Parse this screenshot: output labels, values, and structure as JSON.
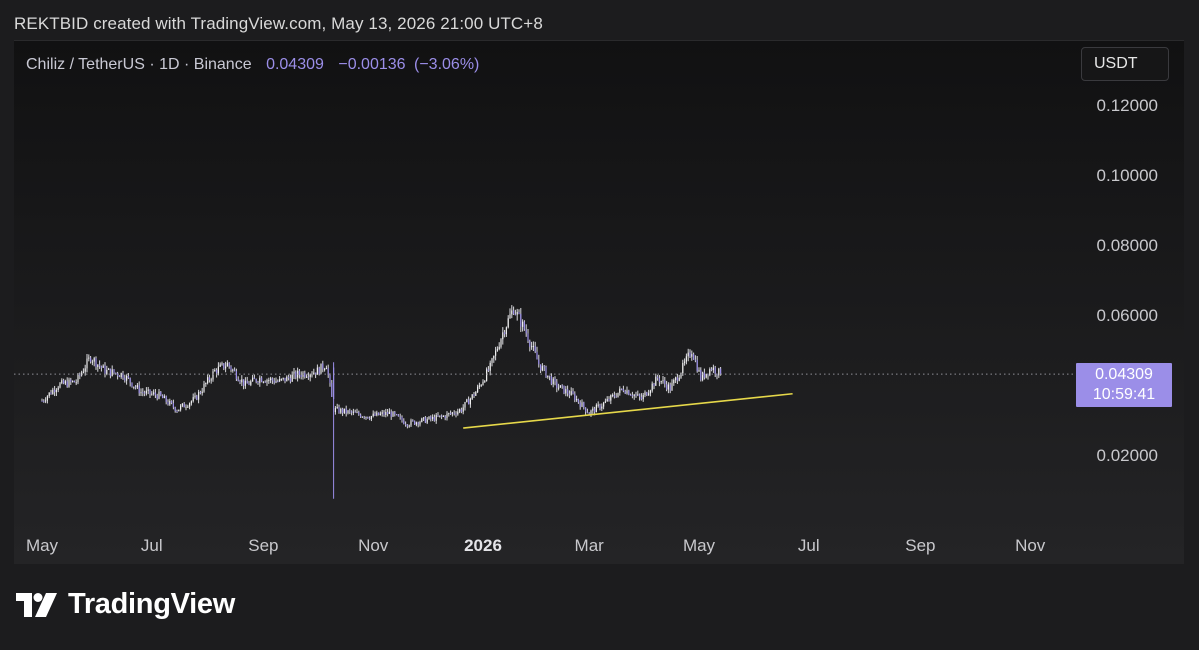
{
  "header": {
    "attribution": "REKTBID created with TradingView.com, May 13, 2026 21:00 UTC+8"
  },
  "symbol": {
    "name": "Chiliz / TetherUS",
    "interval": "1D",
    "exchange": "Binance",
    "last_price": "0.04309",
    "change": "−0.00136",
    "change_pct": "(−3.06%)"
  },
  "currency": "USDT",
  "price_tag": {
    "price": "0.04309",
    "countdown": "10:59:41"
  },
  "logo": {
    "text": "TradingView"
  },
  "colors": {
    "accent": "#9b8ee8",
    "trendline": "#e6d84a",
    "candles": "#e8e8e8",
    "background": "#161617"
  },
  "chart_data": {
    "type": "candlestick",
    "title": "Chiliz / TetherUS · 1D · Binance",
    "ylabel": "USDT",
    "ylim": [
      0.005,
      0.13
    ],
    "y_ticks": [
      "0.12000",
      "0.10000",
      "0.08000",
      "0.06000",
      "0.02000"
    ],
    "x_ticks": [
      "May",
      "Jul",
      "Sep",
      "Nov",
      "2026",
      "Mar",
      "May",
      "Jul",
      "Sep",
      "Nov"
    ],
    "last_price": 0.04309,
    "series": [
      {
        "values": [
          [
            "2025-05-01",
            0.0355
          ],
          [
            "2025-05-10",
            0.04
          ],
          [
            "2025-05-20",
            0.041
          ],
          [
            "2025-05-28",
            0.048
          ],
          [
            "2025-06-05",
            0.044
          ],
          [
            "2025-06-15",
            0.043
          ],
          [
            "2025-06-25",
            0.038
          ],
          [
            "2025-07-05",
            0.037
          ],
          [
            "2025-07-15",
            0.033
          ],
          [
            "2025-07-25",
            0.036
          ],
          [
            "2025-08-05",
            0.044
          ],
          [
            "2025-08-12",
            0.046
          ],
          [
            "2025-08-22",
            0.04
          ],
          [
            "2025-08-30",
            0.042
          ],
          [
            "2025-09-10",
            0.041
          ],
          [
            "2025-09-20",
            0.043
          ],
          [
            "2025-10-01",
            0.044
          ],
          [
            "2025-10-06",
            0.046
          ],
          [
            "2025-10-10",
            0.033
          ],
          [
            "2025-10-20",
            0.032
          ],
          [
            "2025-10-30",
            0.031
          ],
          [
            "2025-11-10",
            0.032
          ],
          [
            "2025-11-20",
            0.029
          ],
          [
            "2025-11-30",
            0.03
          ],
          [
            "2025-12-10",
            0.031
          ],
          [
            "2025-12-20",
            0.033
          ],
          [
            "2025-12-28",
            0.038
          ],
          [
            "2026-01-05",
            0.045
          ],
          [
            "2026-01-12",
            0.055
          ],
          [
            "2026-01-18",
            0.062
          ],
          [
            "2026-01-25",
            0.055
          ],
          [
            "2026-02-01",
            0.046
          ],
          [
            "2026-02-10",
            0.04
          ],
          [
            "2026-02-20",
            0.037
          ],
          [
            "2026-03-01",
            0.032
          ],
          [
            "2026-03-10",
            0.035
          ],
          [
            "2026-03-20",
            0.039
          ],
          [
            "2026-03-30",
            0.036
          ],
          [
            "2026-04-08",
            0.042
          ],
          [
            "2026-04-15",
            0.039
          ],
          [
            "2026-04-22",
            0.045
          ],
          [
            "2026-04-27",
            0.05
          ],
          [
            "2026-05-02",
            0.042
          ],
          [
            "2026-05-08",
            0.045
          ],
          [
            "2026-05-13",
            0.04309
          ]
        ]
      }
    ],
    "annotations": [
      {
        "type": "trendline",
        "points": [
          [
            "2025-12-21",
            0.0277
          ],
          [
            "2026-06-22",
            0.0375
          ]
        ]
      }
    ]
  }
}
